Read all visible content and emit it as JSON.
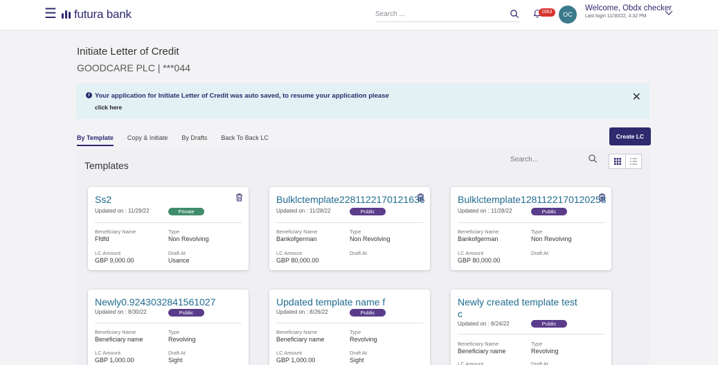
{
  "header": {
    "brand": "futura bank",
    "search_placeholder": "Search ...",
    "notification_count": "1663",
    "avatar_initials": "OC",
    "welcome": "Welcome, Obdx checker",
    "last_login": "Last login 11/30/22, 4:32 PM"
  },
  "page": {
    "title": "Initiate Letter of Credit",
    "subtitle": "GOODCARE PLC | ***044"
  },
  "alert": {
    "message": "Your application for Initiate Letter of Credit was auto saved, to resume your application please",
    "link": "click here"
  },
  "tabs": [
    "By Template",
    "Copy & Initiate",
    "By Drafts",
    "Back To Back LC"
  ],
  "create_button": "Create LC",
  "templates": {
    "title": "Templates",
    "search_placeholder": "Search...",
    "labels": {
      "beneficiary": "Beneficiary Name",
      "type": "Type",
      "amount": "LC Amount",
      "draft": "Draft At"
    },
    "cards": [
      {
        "name": "Ss2",
        "updated": "Updated on : 11/29/22",
        "visibility": "Private",
        "beneficiary": "Ffdfd",
        "type": "Non Revolving",
        "amount": "GBP 9,000.00",
        "draft": "Usance"
      },
      {
        "name": "Bulklctemplate2281122170121636",
        "updated": "Updated on : 11/28/22",
        "visibility": "Public",
        "beneficiary": "Bankofgerman",
        "type": "Non Revolving",
        "amount": "GBP 80,000.00",
        "draft": ""
      },
      {
        "name": "Bulklctemplate1281122170120258",
        "updated": "Updated on : 11/28/22",
        "visibility": "Public",
        "beneficiary": "Bankofgerman",
        "type": "Non Revolving",
        "amount": "GBP 80,000.00",
        "draft": ""
      },
      {
        "name": "Newly0.9243032841561027",
        "updated": "Updated on : 8/30/22",
        "visibility": "Public",
        "beneficiary": "Beneficiary name",
        "type": "Revolving",
        "amount": "GBP 1,000.00",
        "draft": "Sight"
      },
      {
        "name": "Updated template name f",
        "updated": "Updated on : 8/26/22",
        "visibility": "Public",
        "beneficiary": "Beneficiary name",
        "type": "Revolving",
        "amount": "GBP 1,000.00",
        "draft": "Sight"
      },
      {
        "name": "Newly created template test",
        "name_line2": "c",
        "updated": "Updated on : 8/24/22",
        "visibility": "Public",
        "beneficiary": "Beneficiary name",
        "type": "Revolving",
        "amount": "",
        "draft": ""
      }
    ]
  },
  "colors": {
    "brand": "#2d2a6e",
    "link": "#1f6b8f",
    "alert_bg": "#e3f1f5",
    "private_badge": "#3f8c6a",
    "public_badge": "#5a3c8a",
    "notification_badge": "#d6342e"
  },
  "icons": [
    "hamburger-icon",
    "logo-icon",
    "search-icon",
    "bell-icon",
    "chevron-down-icon",
    "info-icon",
    "close-icon",
    "trash-icon",
    "grid-view-icon",
    "list-view-icon"
  ]
}
